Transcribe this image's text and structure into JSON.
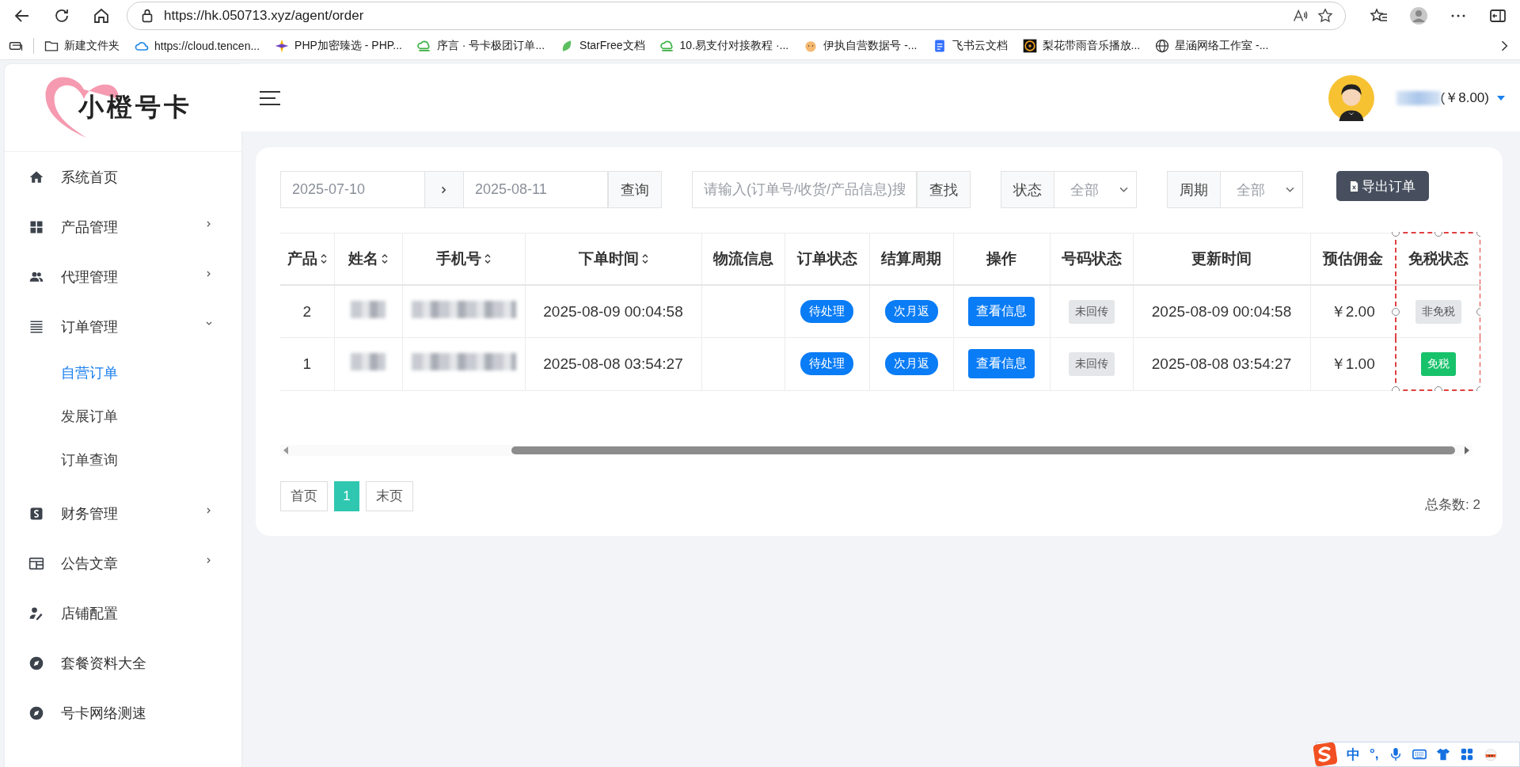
{
  "browser": {
    "url": "https://hk.050713.xyz/agent/order",
    "bookmarks": [
      {
        "label": "新建文件夹",
        "kind": "folder"
      },
      {
        "label": "https://cloud.tencen...",
        "kind": "cloud"
      },
      {
        "label": "PHP加密臻选 - PHP...",
        "kind": "sparkle"
      },
      {
        "label": "序言 · 号卡极团订单...",
        "kind": "greencloud"
      },
      {
        "label": "StarFree文档",
        "kind": "leaf"
      },
      {
        "label": "10.易支付对接教程 ·...",
        "kind": "greencloud"
      },
      {
        "label": "伊执自营数据号 -...",
        "kind": "face"
      },
      {
        "label": "飞书云文档",
        "kind": "doc"
      },
      {
        "label": "梨花带雨音乐播放...",
        "kind": "music"
      },
      {
        "label": "星涵网络工作室 -...",
        "kind": "globe"
      }
    ]
  },
  "logo": "小橙号卡",
  "sidebar": {
    "items": [
      {
        "label": "系统首页",
        "kind": "home",
        "expandable": false
      },
      {
        "label": "产品管理",
        "kind": "grid",
        "expandable": true,
        "expanded": false
      },
      {
        "label": "代理管理",
        "kind": "people",
        "expandable": true,
        "expanded": false
      },
      {
        "label": "订单管理",
        "kind": "list",
        "expandable": true,
        "expanded": true,
        "children": [
          {
            "label": "自营订单",
            "selected": true
          },
          {
            "label": "发展订单",
            "selected": false
          },
          {
            "label": "订单查询",
            "selected": false
          }
        ]
      },
      {
        "label": "财务管理",
        "kind": "dollar",
        "expandable": true,
        "expanded": false
      },
      {
        "label": "公告文章",
        "kind": "news",
        "expandable": true,
        "expanded": false
      },
      {
        "label": "店铺配置",
        "kind": "useredit",
        "expandable": false
      },
      {
        "label": "套餐资料大全",
        "kind": "compass",
        "expandable": false
      },
      {
        "label": "号卡网络测速",
        "kind": "compass",
        "expandable": false
      }
    ]
  },
  "header": {
    "balance": "(￥8.00)"
  },
  "filters": {
    "date_from": "2025-07-10",
    "date_to": "2025-08-11",
    "query_button": "查询",
    "search": {
      "placeholder": "请输入(订单号/收货/产品信息)搜",
      "button": "查找"
    },
    "status": {
      "label": "状态",
      "value": "全部"
    },
    "cycle": {
      "label": "周期",
      "value": "全部"
    },
    "export_button": "导出订单"
  },
  "table": {
    "columns": [
      {
        "label": "产品",
        "sortable": true,
        "highlighted": false
      },
      {
        "label": "姓名",
        "sortable": true,
        "highlighted": false
      },
      {
        "label": "手机号",
        "sortable": true,
        "highlighted": false
      },
      {
        "label": "下单时间",
        "sortable": true,
        "highlighted": false
      },
      {
        "label": "物流信息",
        "sortable": false,
        "highlighted": false
      },
      {
        "label": "订单状态",
        "sortable": false,
        "highlighted": false
      },
      {
        "label": "结算周期",
        "sortable": false,
        "highlighted": false
      },
      {
        "label": "操作",
        "sortable": false,
        "highlighted": false
      },
      {
        "label": "号码状态",
        "sortable": false,
        "highlighted": false
      },
      {
        "label": "更新时间",
        "sortable": false,
        "highlighted": false
      },
      {
        "label": "预估佣金",
        "sortable": false,
        "highlighted": false
      },
      {
        "label": "免税状态",
        "sortable": false,
        "highlighted": true
      }
    ],
    "rows": [
      {
        "product": "2",
        "order_time": "2025-08-09 00:04:58",
        "order_status": "待处理",
        "cycle": "次月返",
        "action": "查看信息",
        "number_status": "未回传",
        "update_time": "2025-08-09 00:04:58",
        "commission": "￥2.00",
        "tax": {
          "label": "非免税",
          "exempt": false
        }
      },
      {
        "product": "1",
        "order_time": "2025-08-08 03:54:27",
        "order_status": "待处理",
        "cycle": "次月返",
        "action": "查看信息",
        "number_status": "未回传",
        "update_time": "2025-08-08 03:54:27",
        "commission": "￥1.00",
        "tax": {
          "label": "免税",
          "exempt": true
        }
      }
    ]
  },
  "pagination": {
    "first": "首页",
    "pages": [
      {
        "label": "1",
        "selected": true
      }
    ],
    "last": "末页",
    "total": "总条数: 2"
  },
  "ime_toolbar": {
    "mode": "中",
    "punctuation": "°,"
  }
}
